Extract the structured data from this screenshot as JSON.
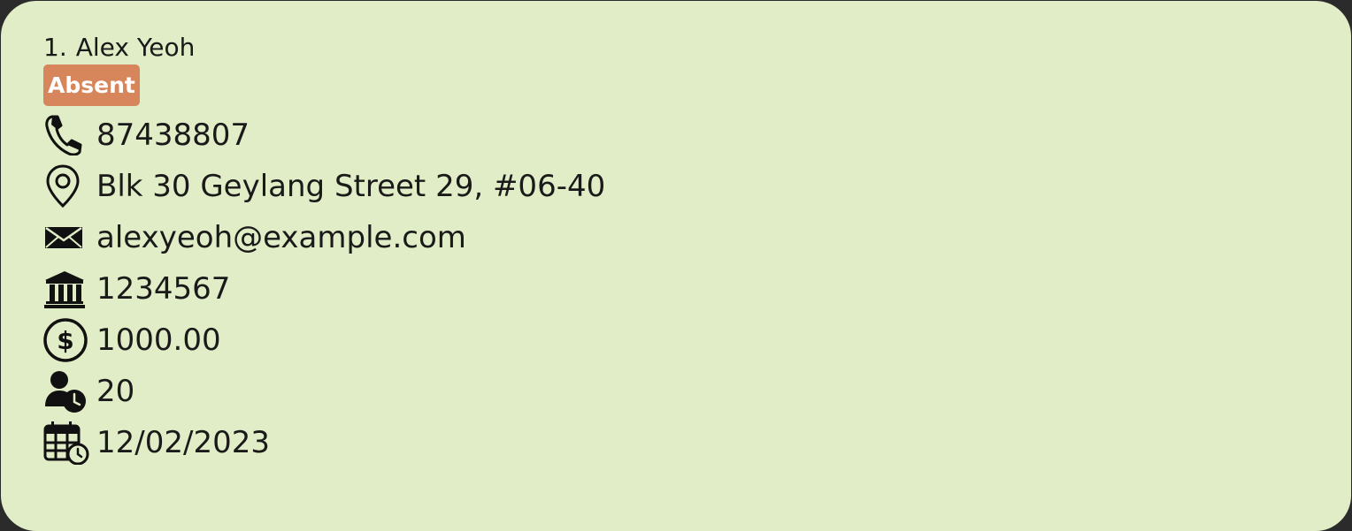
{
  "person": {
    "index": "1.",
    "name": "Alex Yeoh",
    "status": "Absent",
    "phone": "87438807",
    "address": "Blk 30 Geylang Street 29, #06-40",
    "email": "alexyeoh@example.com",
    "bank_account": "1234567",
    "salary": "1000.00",
    "hours": "20",
    "date": "12/02/2023"
  },
  "icons": {
    "phone": "phone-icon",
    "address": "location-pin-icon",
    "email": "envelope-icon",
    "bank": "bank-icon",
    "salary": "dollar-circle-icon",
    "hours": "person-clock-icon",
    "date": "calendar-clock-icon"
  },
  "colors": {
    "card_background": "#e1edc6",
    "badge_absent": "#d7855a",
    "text": "#1a1a1a"
  }
}
